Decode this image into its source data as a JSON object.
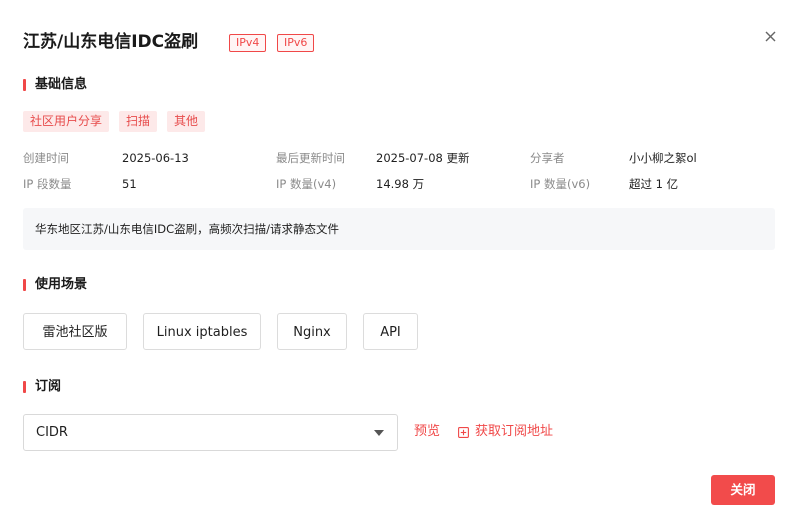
{
  "dialog": {
    "title": "江苏/山东电信IDC盗刷",
    "protocol_tags": [
      "IPv4",
      "IPv6"
    ],
    "close_icon": "close-icon"
  },
  "basic_info": {
    "heading": "基础信息",
    "category_tags": [
      "社区用户分享",
      "扫描",
      "其他"
    ],
    "fields": [
      {
        "label": "创建时间",
        "value": "2025-06-13"
      },
      {
        "label": "最后更新时间",
        "value": "2025-07-08 更新"
      },
      {
        "label": "分享者",
        "value": "小小柳之絮ol"
      },
      {
        "label": "IP 段数量",
        "value": "51"
      },
      {
        "label": "IP 数量(v4)",
        "value": "14.98 万"
      },
      {
        "label": "IP 数量(v6)",
        "value": "超过 1 亿"
      }
    ],
    "description": "华东地区江苏/山东电信IDC盗刷，高频次扫描/请求静态文件"
  },
  "usage": {
    "heading": "使用场景",
    "options": [
      "雷池社区版",
      "Linux iptables",
      "Nginx",
      "API"
    ]
  },
  "subscribe": {
    "heading": "订阅",
    "format_selected": "CIDR",
    "preview_label": "预览",
    "get_url_label": "获取订阅地址"
  },
  "footer": {
    "close_label": "关闭"
  },
  "colors": {
    "accent": "#f04848",
    "tag_bg": "#fde9e9",
    "desc_bg": "#f6f7f9"
  }
}
